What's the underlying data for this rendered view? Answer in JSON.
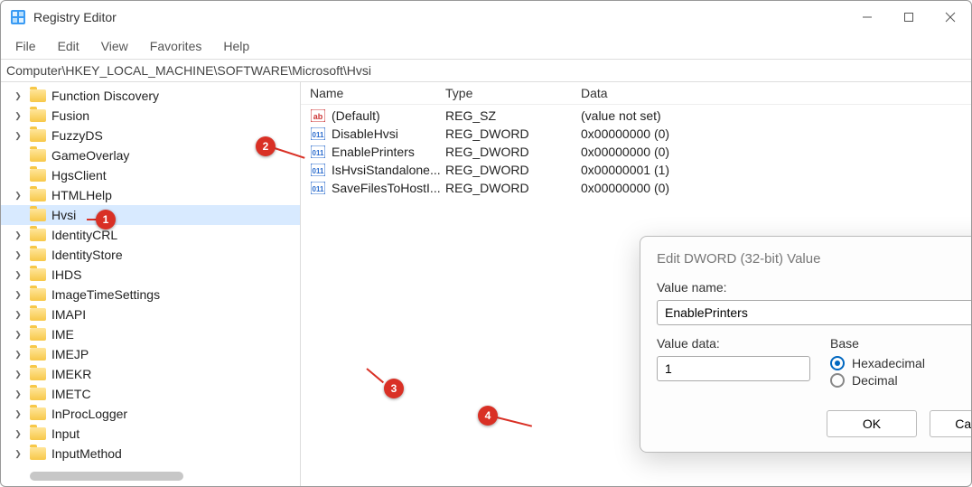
{
  "window": {
    "title": "Registry Editor"
  },
  "menu": [
    "File",
    "Edit",
    "View",
    "Favorites",
    "Help"
  ],
  "address": "Computer\\HKEY_LOCAL_MACHINE\\SOFTWARE\\Microsoft\\Hvsi",
  "tree": [
    {
      "label": "Function Discovery",
      "exp": true
    },
    {
      "label": "Fusion",
      "exp": true
    },
    {
      "label": "FuzzyDS",
      "exp": true
    },
    {
      "label": "GameOverlay",
      "exp": false
    },
    {
      "label": "HgsClient",
      "exp": false
    },
    {
      "label": "HTMLHelp",
      "exp": true
    },
    {
      "label": "Hvsi",
      "exp": false,
      "selected": true
    },
    {
      "label": "IdentityCRL",
      "exp": true
    },
    {
      "label": "IdentityStore",
      "exp": true
    },
    {
      "label": "IHDS",
      "exp": true
    },
    {
      "label": "ImageTimeSettings",
      "exp": true
    },
    {
      "label": "IMAPI",
      "exp": true
    },
    {
      "label": "IME",
      "exp": true
    },
    {
      "label": "IMEJP",
      "exp": true
    },
    {
      "label": "IMEKR",
      "exp": true
    },
    {
      "label": "IMETC",
      "exp": true
    },
    {
      "label": "InProcLogger",
      "exp": true
    },
    {
      "label": "Input",
      "exp": true
    },
    {
      "label": "InputMethod",
      "exp": true
    }
  ],
  "columns": {
    "name": "Name",
    "type": "Type",
    "data": "Data"
  },
  "values": [
    {
      "icon": "sz",
      "name": "(Default)",
      "type": "REG_SZ",
      "data": "(value not set)"
    },
    {
      "icon": "dw",
      "name": "DisableHvsi",
      "type": "REG_DWORD",
      "data": "0x00000000 (0)"
    },
    {
      "icon": "dw",
      "name": "EnablePrinters",
      "type": "REG_DWORD",
      "data": "0x00000000 (0)"
    },
    {
      "icon": "dw",
      "name": "IsHvsiStandalone...",
      "type": "REG_DWORD",
      "data": "0x00000001 (1)"
    },
    {
      "icon": "dw",
      "name": "SaveFilesToHostI...",
      "type": "REG_DWORD",
      "data": "0x00000000 (0)"
    }
  ],
  "dialog": {
    "title": "Edit DWORD (32-bit) Value",
    "value_name_label": "Value name:",
    "value_name": "EnablePrinters",
    "value_data_label": "Value data:",
    "value_data": "1",
    "base_label": "Base",
    "hex_label": "Hexadecimal",
    "dec_label": "Decimal",
    "ok": "OK",
    "cancel": "Cancel"
  },
  "badges": [
    "1",
    "2",
    "3",
    "4"
  ]
}
